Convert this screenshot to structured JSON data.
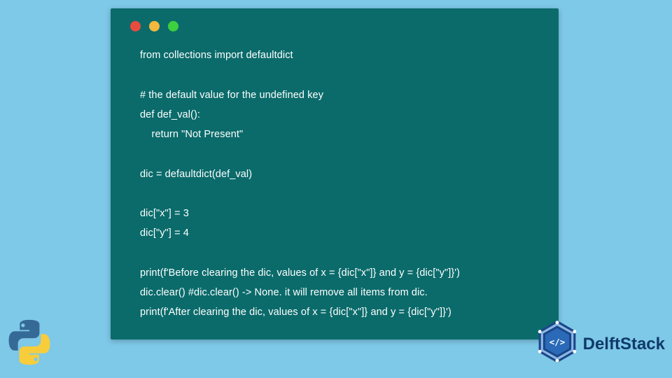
{
  "code": {
    "lines": [
      "from collections import defaultdict",
      "",
      "# the default value for the undefined key",
      "def def_val():",
      "    return \"Not Present\"",
      "",
      "dic = defaultdict(def_val)",
      "",
      "dic[\"x\"] = 3",
      "dic[\"y\"] = 4",
      "",
      "print(f'Before clearing the dic, values of x = {dic[\"x\"]} and y = {dic[\"y\"]}')",
      "dic.clear() #dic.clear() -> None. it will remove all items from dic.",
      "print(f'After clearing the dic, values of x = {dic[\"x\"]} and y = {dic[\"y\"]}')"
    ]
  },
  "brand": {
    "name": "DelftStack"
  },
  "colors": {
    "background": "#7ec8e8",
    "codeblock": "#0b6b6b",
    "text": "#ffffff",
    "brand": "#0e3a6a"
  }
}
